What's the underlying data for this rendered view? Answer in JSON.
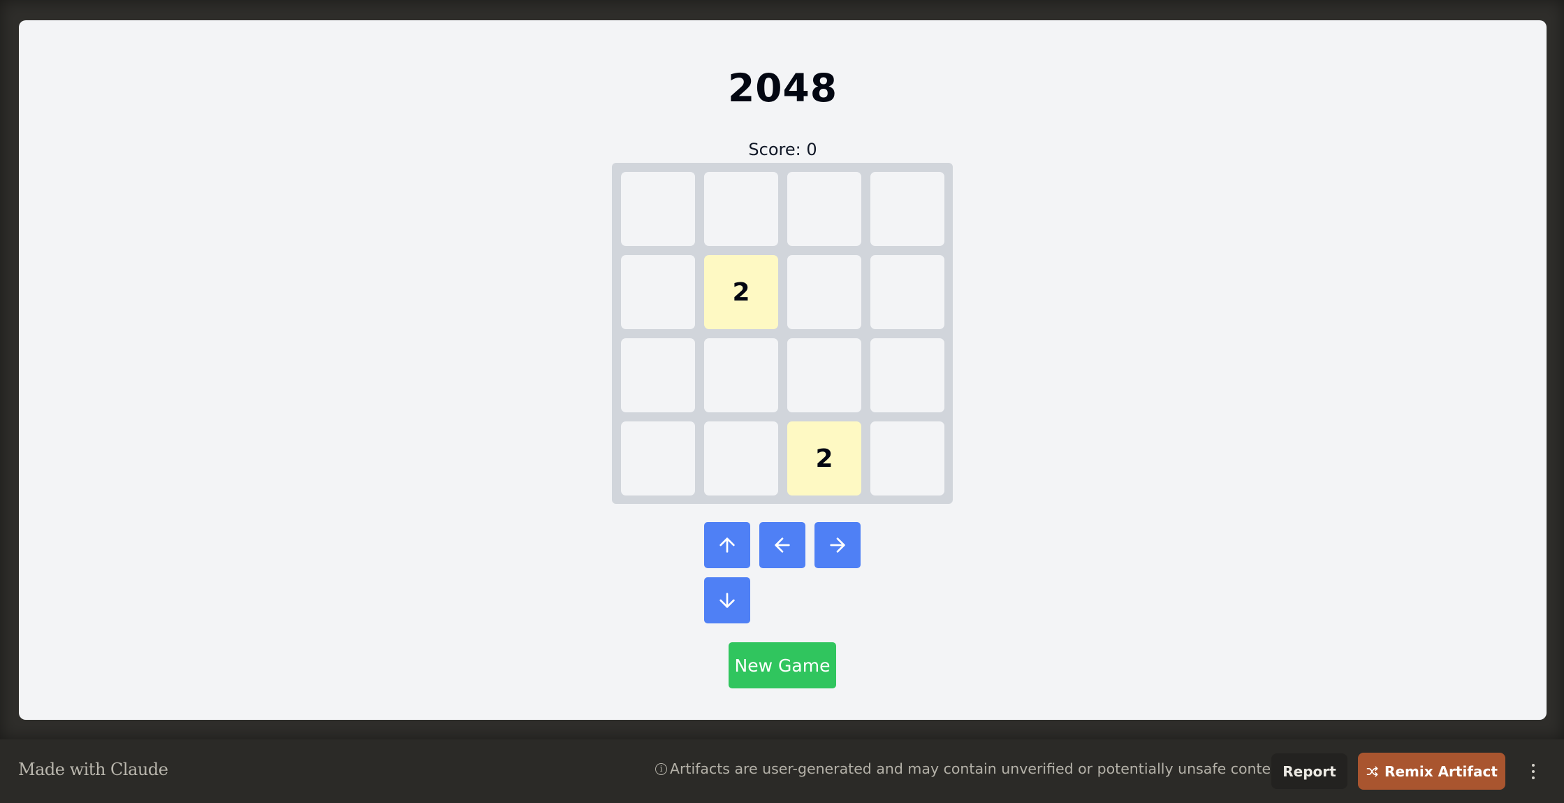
{
  "game": {
    "title": "2048",
    "score_label": "Score: 0",
    "score": 0,
    "board": [
      [
        null,
        null,
        null,
        null
      ],
      [
        null,
        2,
        null,
        null
      ],
      [
        null,
        null,
        null,
        null
      ],
      [
        null,
        null,
        2,
        null
      ]
    ],
    "colors": {
      "board": "#d1d5db",
      "empty_tile": "#f3f4f6",
      "tile_2": "#fef9c3",
      "arrow_button": "#4f80f5",
      "new_game_button": "#30c55e"
    }
  },
  "controls": {
    "up": {
      "icon": "arrow-up-icon",
      "glyph": "↑"
    },
    "left": {
      "icon": "arrow-left-icon",
      "glyph": "←"
    },
    "right": {
      "icon": "arrow-right-icon",
      "glyph": "→"
    },
    "down": {
      "icon": "arrow-down-icon",
      "glyph": "↓"
    },
    "new_game_label": "New Game"
  },
  "footer": {
    "made_with": "Made with Claude",
    "disclaimer_icon": "info-icon",
    "disclaimer": "Artifacts are user-generated and may contain unverified or potentially unsafe content.",
    "report_label": "Report",
    "remix_icon": "shuffle-icon",
    "remix_label": "Remix Artifact",
    "more_icon": "kebab-menu-icon",
    "colors": {
      "background": "#2b2a27",
      "remix_button": "#a9552f",
      "report_button": "#232220"
    }
  }
}
